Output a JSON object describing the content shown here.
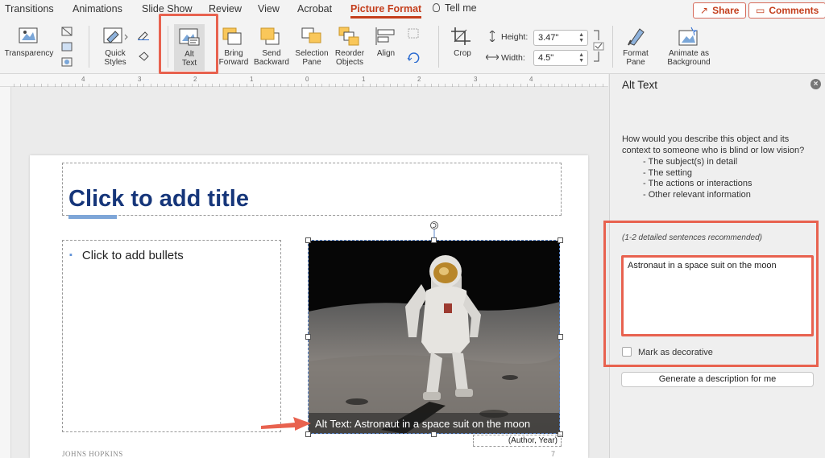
{
  "tabs": [
    "Transitions",
    "Animations",
    "Slide Show",
    "Review",
    "View",
    "Acrobat",
    "Picture Format"
  ],
  "active_tab": "Picture Format",
  "tell_me": "Tell me",
  "share_label": "Share",
  "comments_label": "Comments",
  "ribbon": {
    "transparency": "Transparency",
    "quick_styles_1": "Quick",
    "quick_styles_2": "Styles",
    "alt_text_1": "Alt",
    "alt_text_2": "Text",
    "bring_forward_1": "Bring",
    "bring_forward_2": "Forward",
    "send_backward_1": "Send",
    "send_backward_2": "Backward",
    "selection_pane_1": "Selection",
    "selection_pane_2": "Pane",
    "reorder_objects_1": "Reorder",
    "reorder_objects_2": "Objects",
    "align": "Align",
    "crop": "Crop",
    "height_label": "Height:",
    "height_value": "3.47\"",
    "width_label": "Width:",
    "width_value": "4.5\"",
    "format_pane_1": "Format",
    "format_pane_2": "Pane",
    "animate_bg_1": "Animate as",
    "animate_bg_2": "Background"
  },
  "ruler_numbers": [
    "4",
    "3",
    "2",
    "1",
    "0",
    "1",
    "2",
    "3",
    "4"
  ],
  "slide": {
    "title": "Click to add title",
    "bullet": "Click to add bullets",
    "caption": "Alt Text: Astronaut in a space suit on the moon",
    "author": "(Author, Year)",
    "logo_text": "JOHNS HOPKINS",
    "page_number": "7"
  },
  "alt_pane": {
    "title": "Alt Text",
    "description": "How would you describe this object and its context to someone who is blind or low vision?",
    "list": [
      "- The subject(s) in detail",
      "- The setting",
      "- The actions or interactions",
      "- Other relevant information"
    ],
    "hint": "(1-2 detailed sentences recommended)",
    "value": "Astronaut in a space suit on the moon",
    "decorative_label": "Mark as decorative",
    "generate_label": "Generate a description for me"
  },
  "colors": {
    "accent": "#c43e1c",
    "highlight": "#e8624f",
    "title_blue": "#16367a"
  }
}
